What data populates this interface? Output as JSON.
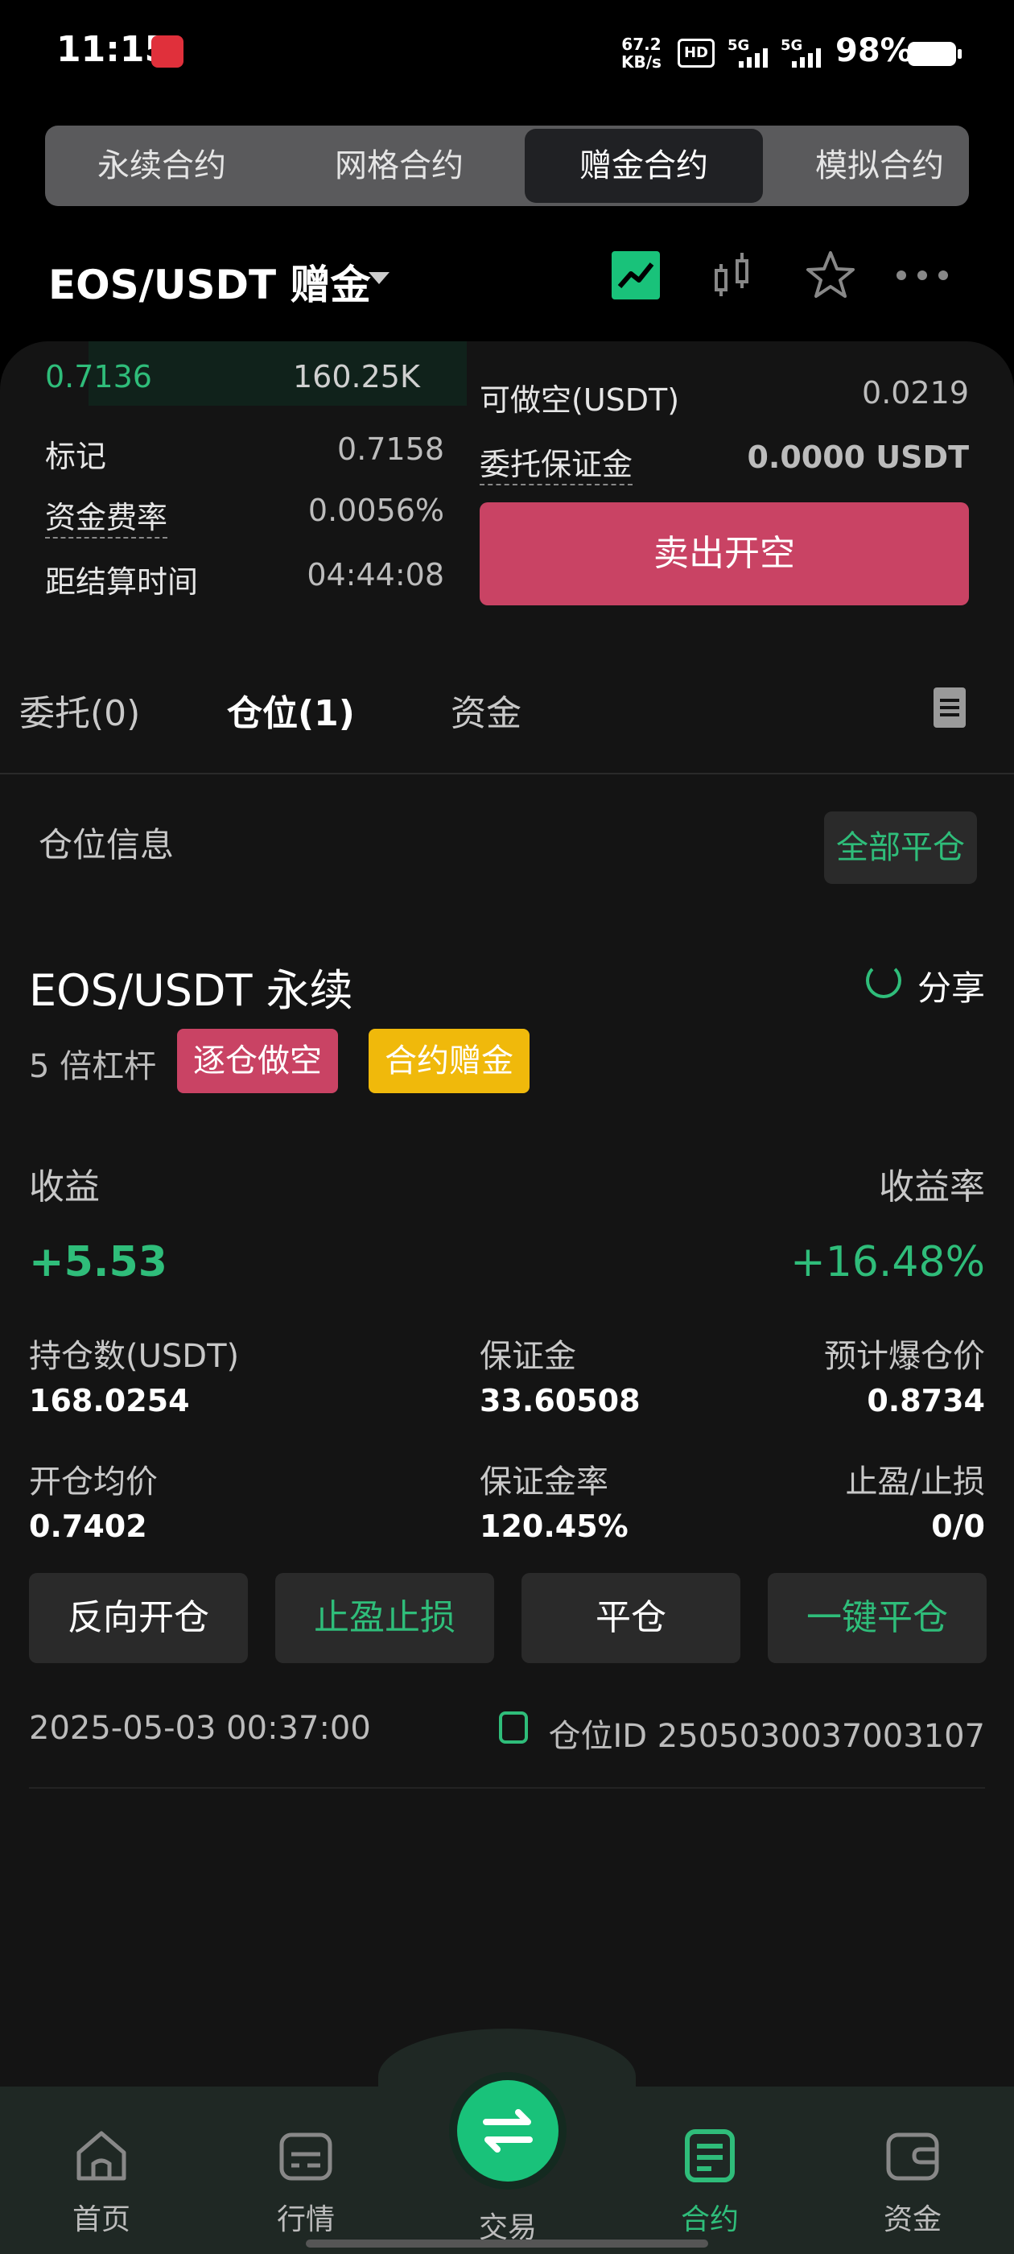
{
  "status_bar": {
    "time": "11:15",
    "speed_value": "67.2",
    "speed_unit": "KB/s",
    "hd_label": "HD",
    "signal_1": "5G",
    "signal_2": "5G",
    "battery": "98%"
  },
  "contract_tabs": [
    "永续合约",
    "网格合约",
    "赠金合约",
    "模拟合约"
  ],
  "active_tab_index": 2,
  "header": {
    "pair": "EOS/USDT  赠金"
  },
  "order_book": {
    "price": "0.7136",
    "volume": "160.25K"
  },
  "info": {
    "mark_label": "标记",
    "mark_value": "0.7158",
    "funding_label": "资金费率",
    "funding_value": "0.0056%",
    "settle_label": "距结算时间",
    "settle_value": "04:44:08"
  },
  "right_panel": {
    "shortable_label": "可做空(USDT)",
    "shortable_value": "0.0219",
    "margin_label": "委托保证金",
    "margin_value": "0.0000 USDT",
    "sell_button": "卖出开空"
  },
  "sub_tabs": [
    "委托(0)",
    "仓位(1)",
    "资金"
  ],
  "position": {
    "section_title": "仓位信息",
    "close_all": "全部平仓",
    "title": "EOS/USDT 永续",
    "share": "分享",
    "leverage": "5 倍杠杆",
    "tag_mode": "逐仓做空",
    "tag_bonus": "合约赠金",
    "pnl_label": "收益",
    "pnl_value": "+5.53",
    "roi_label": "收益率",
    "roi_value": "+16.48%",
    "size_label": "持仓数(USDT)",
    "size_value": "168.0254",
    "margin_label": "保证金",
    "margin_value": "33.60508",
    "liq_label": "预计爆仓价",
    "liq_value": "0.8734",
    "entry_label": "开仓均价",
    "entry_value": "0.7402",
    "ratio_label": "保证金率",
    "ratio_value": "120.45%",
    "tpsl_label": "止盈/止损",
    "tpsl_value": "0/0",
    "actions": [
      "反向开仓",
      "止盈止损",
      "平仓",
      "一键平仓"
    ],
    "timestamp": "2025-05-03 00:37:00",
    "position_id": "仓位ID 2505030037003107"
  },
  "bottom_nav": [
    "首页",
    "行情",
    "交易",
    "合约",
    "资金"
  ],
  "colors": {
    "green": "#2fbd7a",
    "red": "#c94364",
    "yellow": "#f0b90b"
  }
}
